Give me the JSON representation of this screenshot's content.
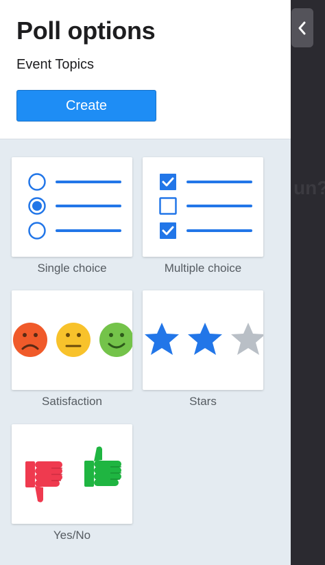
{
  "panel": {
    "title": "Poll options",
    "subtitle": "Event Topics",
    "create_label": "Create"
  },
  "poll_types": [
    {
      "label": "Single choice",
      "icon": "single-choice-icon"
    },
    {
      "label": "Multiple choice",
      "icon": "multiple-choice-icon"
    },
    {
      "label": "Satisfaction",
      "icon": "satisfaction-faces-icon"
    },
    {
      "label": "Stars",
      "icon": "stars-icon"
    },
    {
      "label": "Yes/No",
      "icon": "thumbs-icon"
    }
  ],
  "colors": {
    "accent": "#1e8df5",
    "panel_bg": "#e4ebf1",
    "dark_bg": "#2b2a30",
    "sad": "#f05a2a",
    "neutral": "#f8c22b",
    "happy": "#74c34a",
    "star_active": "#2276e8",
    "star_inactive": "#b9bfc6",
    "thumbs_down": "#ef3a4f",
    "thumbs_up": "#1fb541"
  },
  "stars_shown": {
    "filled": 2,
    "total": 3
  },
  "collapse_icon": "chevron-left-icon"
}
